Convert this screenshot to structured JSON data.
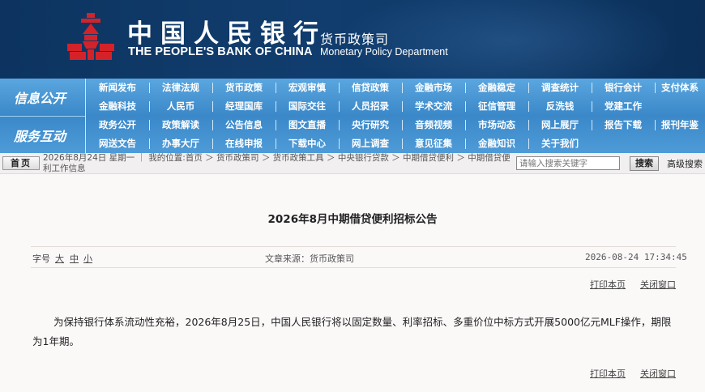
{
  "header": {
    "bank_name_cn": "中国人民银行",
    "bank_name_en": "THE PEOPLE'S BANK OF CHINA",
    "dept_cn": "货币政策司",
    "dept_en": "Monetary Policy Department",
    "logo_color": "#d2232a"
  },
  "nav": {
    "section1": "信息公开",
    "section2": "服务互动",
    "row1": [
      "新闻发布",
      "法律法规",
      "货币政策",
      "宏观审慎",
      "信贷政策",
      "金融市场",
      "金融稳定",
      "调查统计",
      "银行会计",
      "支付体系"
    ],
    "row2": [
      "金融科技",
      "人民币",
      "经理国库",
      "国际交往",
      "人员招录",
      "学术交流",
      "征信管理",
      "反洗钱",
      "党建工作"
    ],
    "row3": [
      "政务公开",
      "政策解读",
      "公告信息",
      "图文直播",
      "央行研究",
      "音频视频",
      "市场动态",
      "网上展厅",
      "报告下载",
      "报刊年鉴"
    ],
    "row4": [
      "网送文告",
      "办事大厅",
      "在线申报",
      "下载中心",
      "网上调查",
      "意见征集",
      "金融知识",
      "关于我们"
    ]
  },
  "toolbar": {
    "home_label": "首页",
    "breadcrumb": "2026年8月24日 星期一 ｜ 我的位置:首页 ＞ 货币政策司 ＞ 货币政策工具 ＞ 中央银行贷款 ＞ 中期借贷便利 ＞ 中期借贷便利工作信息",
    "search_placeholder": "请输入搜索关键字",
    "search_label": "搜索",
    "advanced_search": "高级搜索"
  },
  "article": {
    "title": "2026年8月中期借贷便利招标公告",
    "font_size_label": "字号",
    "font_large": "大",
    "font_medium": "中",
    "font_small": "小",
    "source": "文章来源：货币政策司",
    "datetime": "2026-08-24 17:34:45",
    "print_label": "打印本页",
    "close_label": "关闭窗口",
    "body": "为保持银行体系流动性充裕，2026年8月25日，中国人民银行将以固定数量、利率招标、多重价位中标方式开展5000亿元MLF操作，期限为1年期。"
  },
  "colors": {
    "header_bg": "#0d3460",
    "nav_bg": "#3b88c9"
  }
}
